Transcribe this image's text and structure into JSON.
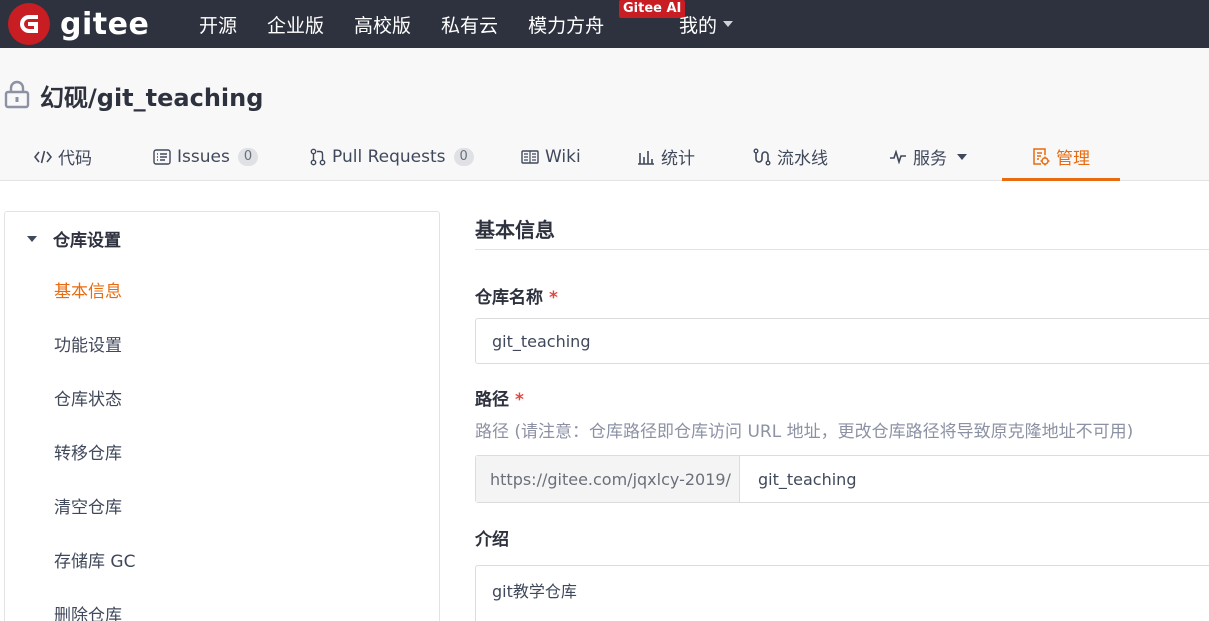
{
  "topbar": {
    "brand": "gitee",
    "nav": [
      "开源",
      "企业版",
      "高校版",
      "私有云",
      "模力方舟"
    ],
    "badge": "Gitee AI",
    "mine": "我的"
  },
  "project": {
    "title": "幻砚/git_teaching",
    "tabs": [
      {
        "label": "代码",
        "icon": "code-icon"
      },
      {
        "label": "Issues",
        "count": "0",
        "icon": "issues-icon"
      },
      {
        "label": "Pull Requests",
        "count": "0",
        "icon": "pull-request-icon"
      },
      {
        "label": "Wiki",
        "icon": "wiki-icon"
      },
      {
        "label": "统计",
        "icon": "chart-icon"
      },
      {
        "label": "流水线",
        "icon": "pipeline-icon"
      },
      {
        "label": "服务",
        "icon": "pulse-icon"
      },
      {
        "label": "管理",
        "icon": "manage-icon",
        "active": true
      }
    ]
  },
  "sidebar": {
    "group": "仓库设置",
    "items": [
      "基本信息",
      "功能设置",
      "仓库状态",
      "转移仓库",
      "清空仓库",
      "存储库 GC",
      "删除仓库"
    ]
  },
  "form": {
    "section": "基本信息",
    "name_label": "仓库名称",
    "name_value": "git_teaching",
    "path_label": "路径",
    "path_hint": "路径 (请注意：仓库路径即仓库访问 URL 地址，更改仓库路径将导致原克隆地址不可用)",
    "path_prefix": "https://gitee.com/jqxlcy-2019/",
    "path_value": "git_teaching",
    "intro_label": "介绍",
    "intro_value": "git教学仓库",
    "required_mark": "*"
  },
  "colors": {
    "accent": "#e86b0f",
    "brand": "#c71d23",
    "topbar": "#2e323e"
  }
}
